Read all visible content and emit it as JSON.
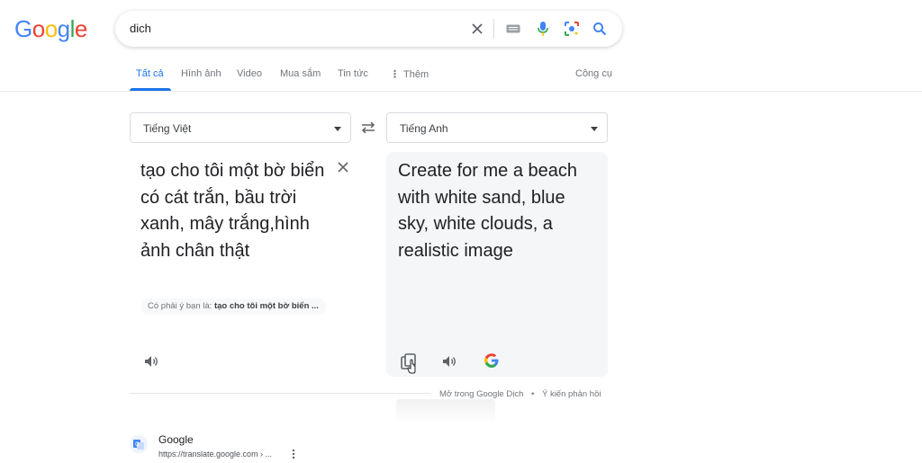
{
  "header": {
    "logo_letters": [
      {
        "ch": "G",
        "color": "#4285F4"
      },
      {
        "ch": "o",
        "color": "#EA4335"
      },
      {
        "ch": "o",
        "color": "#FBBC05"
      },
      {
        "ch": "g",
        "color": "#4285F4"
      },
      {
        "ch": "l",
        "color": "#34A853"
      },
      {
        "ch": "e",
        "color": "#EA4335"
      }
    ],
    "search_query": "dich"
  },
  "tabs": {
    "all": "Tất cả",
    "images": "Hình ảnh",
    "video": "Video",
    "shopping": "Mua sắm",
    "news": "Tin tức",
    "more": "Thêm",
    "tools": "Công cụ"
  },
  "translate": {
    "source_lang": "Tiếng Việt",
    "target_lang": "Tiếng Anh",
    "source_text": "tạo cho tôi một bờ biển có cát trắn, bầu trời xanh, mây trắng,hình ảnh chân thật",
    "suggestion_prefix": "Có phải ý bạn là:",
    "suggestion_value": "tạo cho tôi một bờ biển ...",
    "target_text": "Create for me a beach with white sand, blue sky, white clouds, a realistic image",
    "open_link": "Mở trong Google Dịch",
    "separator": "•",
    "feedback_link": "Ý kiến phản hồi"
  },
  "result": {
    "title": "Google",
    "url": "https://translate.google.com › ..."
  },
  "colors": {
    "accent": "#1a73e8",
    "muted": "#70757a"
  }
}
